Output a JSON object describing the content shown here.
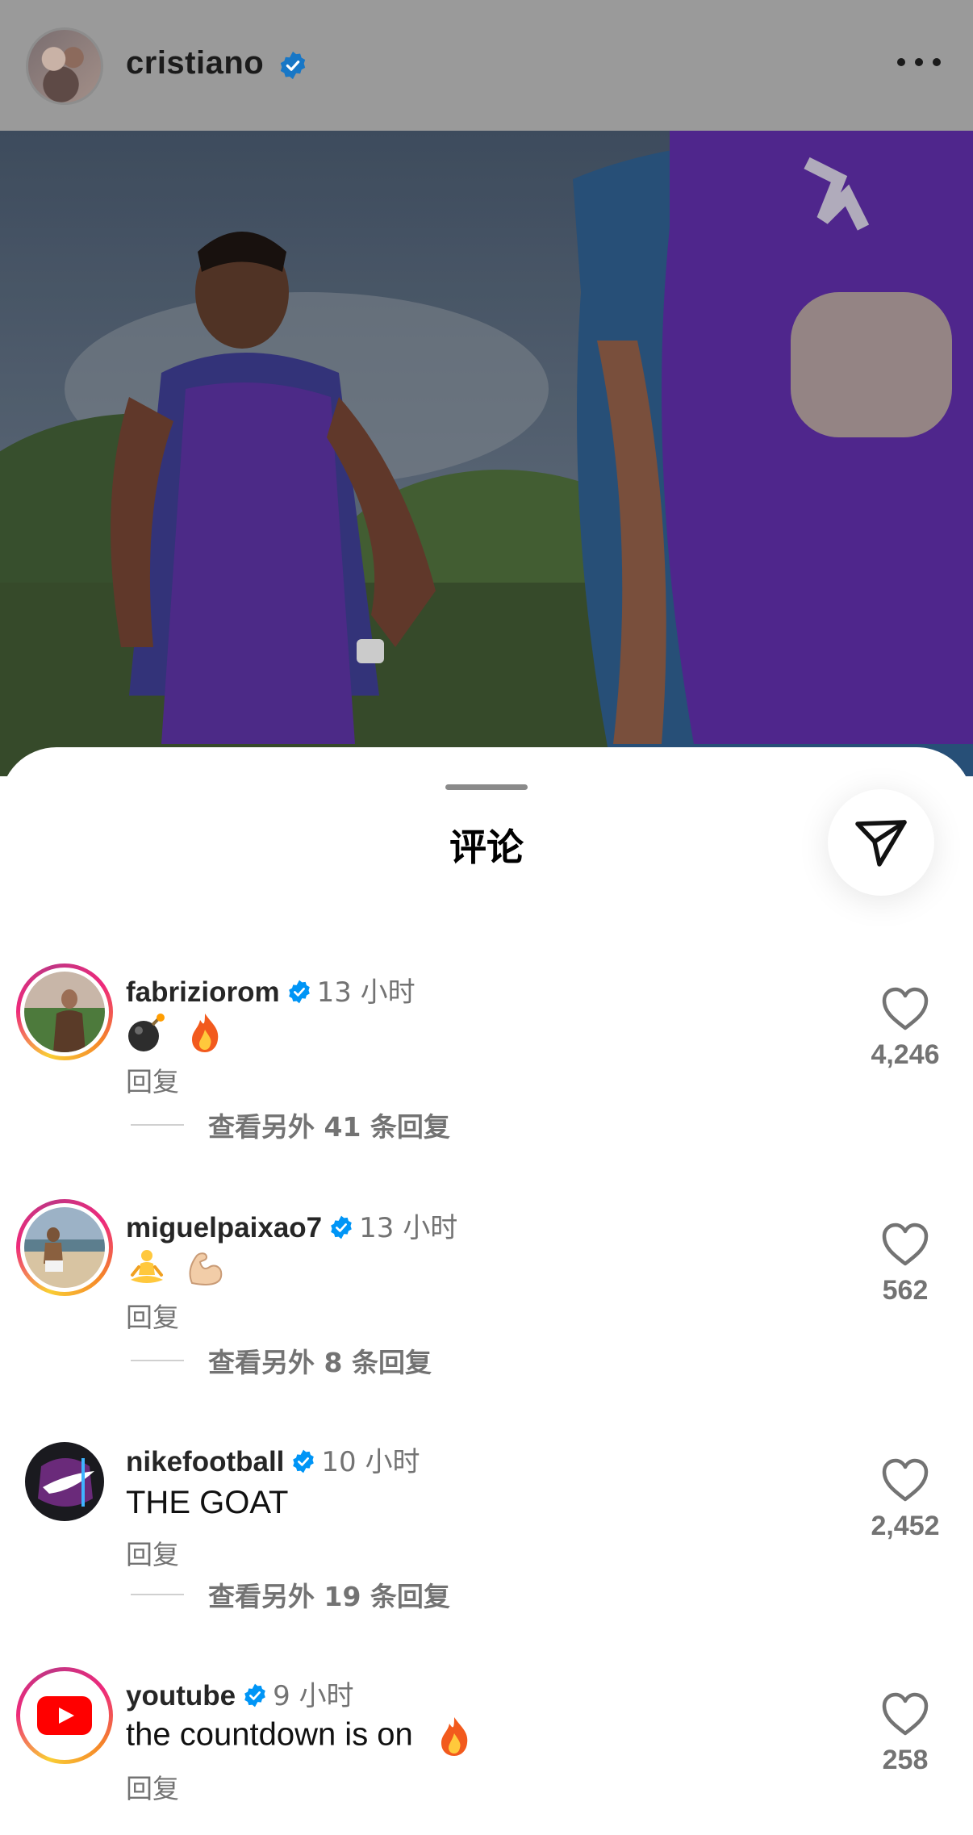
{
  "post": {
    "username": "cristiano",
    "verified": true
  },
  "sheet": {
    "title": "评论"
  },
  "comments": [
    {
      "username": "fabriziorom",
      "time": "13 小时",
      "text": "",
      "emojis": [
        "bomb",
        "fire"
      ],
      "reply_label": "回复",
      "likes": "4,246",
      "more_replies": "查看另外 41 条回复",
      "story_ring": true
    },
    {
      "username": "miguelpaixao7",
      "time": "13 小时",
      "text": "",
      "emojis": [
        "person-in-lotus-position",
        "flexed-biceps"
      ],
      "reply_label": "回复",
      "likes": "562",
      "more_replies": "查看另外 8 条回复",
      "story_ring": true
    },
    {
      "username": "nikefootball",
      "time": "10 小时",
      "text": "THE GOAT",
      "emojis": [],
      "reply_label": "回复",
      "likes": "2,452",
      "more_replies": "查看另外 19 条回复",
      "story_ring": false
    },
    {
      "username": "youtube",
      "time": "9 小时",
      "text": "the countdown is on",
      "emojis": [
        "fire"
      ],
      "reply_label": "回复",
      "likes": "258",
      "more_replies": "",
      "story_ring": true
    }
  ],
  "colors": {
    "verified_blue": "#0095f6",
    "secondary_text": "#737373",
    "header_overlay": "#9a9a9a"
  }
}
